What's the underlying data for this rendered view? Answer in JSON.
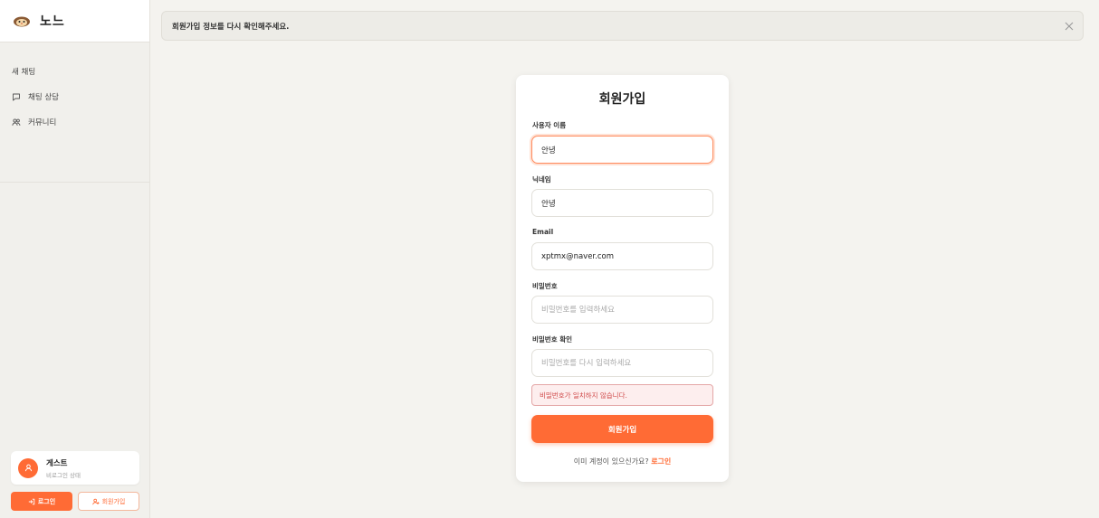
{
  "brand": {
    "name": "노느",
    "logo_icon": "hedgehog-logo-icon"
  },
  "nav": {
    "new_chat": "새 채팅",
    "items": [
      {
        "label": "채팅 상담",
        "icon": "chat-icon"
      },
      {
        "label": "커뮤니티",
        "icon": "users-icon"
      }
    ]
  },
  "user": {
    "name": "게스트",
    "status": "비로그인 상태",
    "login_label": "로그인",
    "signup_label": "회원가입"
  },
  "alert": {
    "message": "회원가입 정보를 다시 확인해주세요."
  },
  "form": {
    "title": "회원가입",
    "fields": [
      {
        "label": "사용자 이름",
        "value": "안녕",
        "placeholder": ""
      },
      {
        "label": "닉네임",
        "value": "안녕",
        "placeholder": ""
      },
      {
        "label": "Email",
        "value": "xptmx@naver.com",
        "placeholder": ""
      },
      {
        "label": "비밀번호",
        "value": "",
        "placeholder": "비밀번호를 입력하세요"
      },
      {
        "label": "비밀번호 확인",
        "value": "",
        "placeholder": "비밀번호를 다시 입력하세요"
      }
    ],
    "error": "비밀번호가 일치하지 않습니다.",
    "submit_label": "회원가입",
    "footer_text": "이미 계정이 있으신가요?",
    "footer_link": "로그인"
  },
  "colors": {
    "accent": "#ff6b35",
    "error": "#d04a4a",
    "background": "#f4f3ef"
  }
}
